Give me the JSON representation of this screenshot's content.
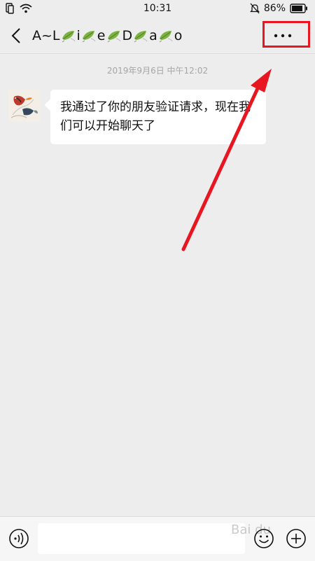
{
  "status_bar": {
    "time": "10:31",
    "battery_percent": "86%"
  },
  "header": {
    "title_parts": [
      "A~L",
      "i",
      "e",
      "D",
      "a",
      "o"
    ]
  },
  "chat": {
    "timestamp": "2019年9月6日 中午12:02",
    "messages": [
      {
        "text": "我通过了你的朋友验证请求，现在我们可以开始聊天了"
      }
    ]
  },
  "input_bar": {
    "value": "",
    "watermark": "Bai du"
  },
  "colors": {
    "annotation_red": "#e81621",
    "background": "#ededed",
    "bubble": "#ffffff"
  },
  "icons": {
    "status": [
      "sim-icon",
      "wifi-icon",
      "mute-icon",
      "battery-icon"
    ],
    "header": [
      "back-icon",
      "more-icon",
      "leaf-emoji-icon"
    ],
    "input": [
      "voice-icon",
      "emoji-icon",
      "plus-icon"
    ]
  }
}
